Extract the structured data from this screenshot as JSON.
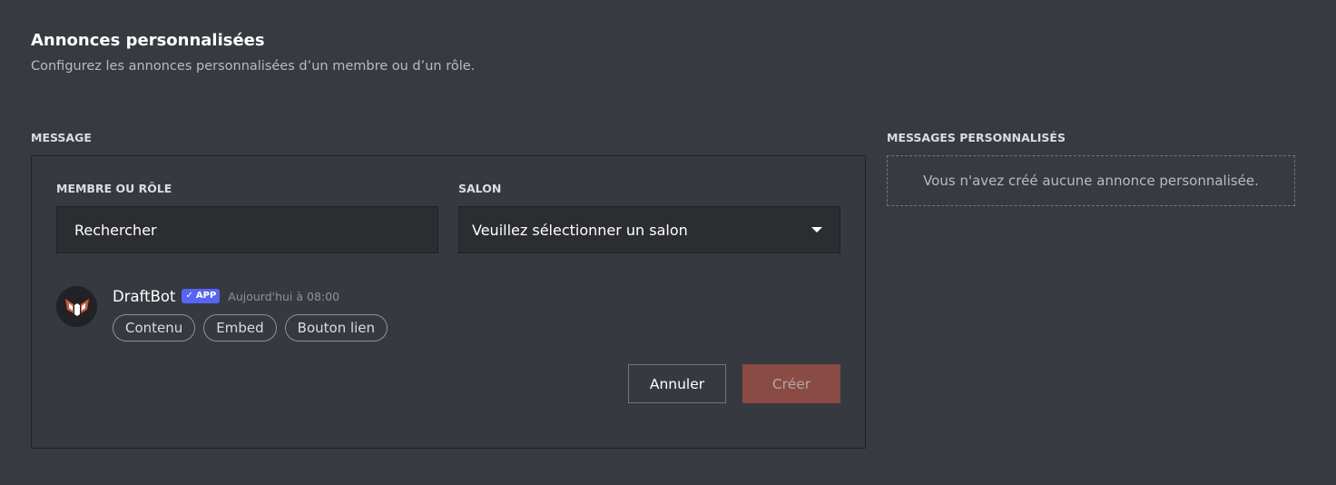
{
  "header": {
    "title": "Annonces personnalisées",
    "subtitle": "Configurez les annonces personnalisées d’un membre ou d’un rôle."
  },
  "message_section": {
    "label": "MESSAGE",
    "member_field": {
      "label": "MEMBRE OU RÔLE",
      "placeholder": "Rechercher"
    },
    "channel_field": {
      "label": "SALON",
      "value": "Veuillez sélectionner un salon"
    },
    "preview": {
      "author": "DraftBot",
      "badge": "APP",
      "badge_check": "✓",
      "timestamp": "Aujourd'hui à 08:00",
      "chips": [
        "Contenu",
        "Embed",
        "Bouton lien"
      ]
    },
    "actions": {
      "cancel": "Annuler",
      "create": "Créer"
    }
  },
  "custom_messages_section": {
    "label": "MESSAGES PERSONNALISÉS",
    "empty_text": "Vous n'avez créé aucune annonce personnalisée."
  },
  "colors": {
    "background": "#373a40",
    "input_bg": "#2b2d31",
    "accent_badge": "#5865f2",
    "create_button": "#8a4b45",
    "logo_accent": "#c85a3c"
  },
  "icons": {
    "avatar": "draftbot-logo-icon",
    "caret": "chevron-down-icon"
  }
}
